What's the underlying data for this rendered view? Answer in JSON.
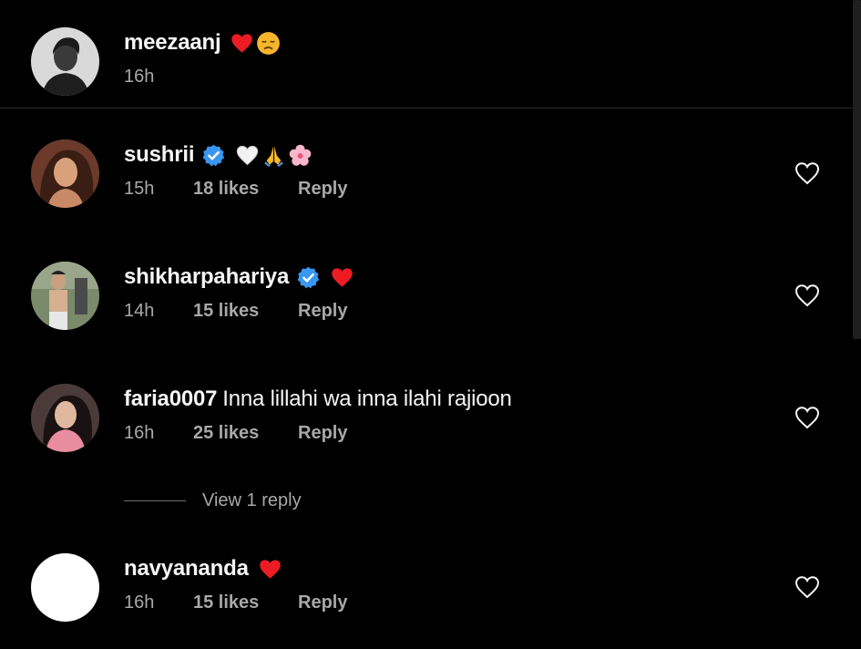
{
  "comments": [
    {
      "username": "meezaanj",
      "text": "",
      "time": "16h",
      "likes": "",
      "reply": "",
      "verified": false,
      "emojis": [
        "red-heart",
        "disappointed-face"
      ]
    },
    {
      "username": "sushrii",
      "text": "",
      "time": "15h",
      "likes": "18 likes",
      "reply": "Reply",
      "verified": true,
      "emojis": [
        "white-heart",
        "folded-hands",
        "cherry-blossom"
      ]
    },
    {
      "username": "shikharpahariya",
      "text": "",
      "time": "14h",
      "likes": "15 likes",
      "reply": "Reply",
      "verified": true,
      "emojis": [
        "red-heart"
      ]
    },
    {
      "username": "faria0007",
      "text": "Inna lillahi wa inna ilahi rajioon",
      "time": "16h",
      "likes": "25 likes",
      "reply": "Reply",
      "verified": false,
      "emojis": []
    },
    {
      "username": "navyananda",
      "text": "",
      "time": "16h",
      "likes": "15 likes",
      "reply": "Reply",
      "verified": false,
      "emojis": [
        "red-heart"
      ]
    }
  ],
  "view_replies": {
    "label": "View 1 reply"
  },
  "colors": {
    "background": "#000000",
    "primary_text": "#f5f5f5",
    "secondary_text": "#a8a8a8",
    "verified_blue": "#3897f0",
    "heart_red": "#ed1c24",
    "divider": "#2b2b2b"
  }
}
